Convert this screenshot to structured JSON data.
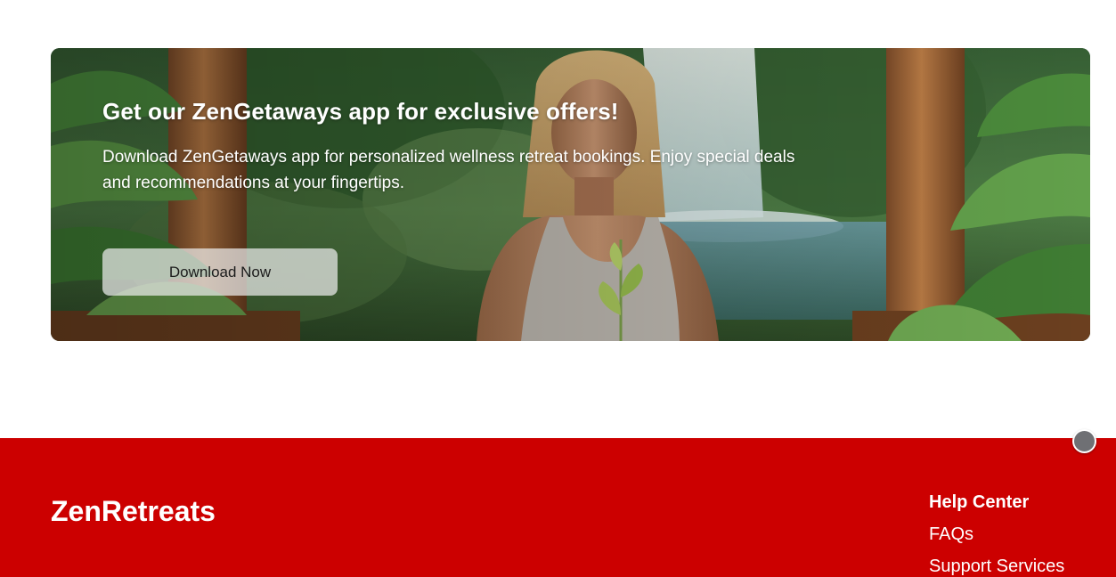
{
  "promo": {
    "title": "Get our ZenGetaways app for exclusive offers!",
    "description": "Download ZenGetaways app for personalized wellness retreat bookings. Enjoy special deals and recommendations at your fingertips.",
    "button_label": "Download Now"
  },
  "footer": {
    "brand": "ZenRetreats",
    "background_color": "#cc0000",
    "help_center": {
      "title": "Help Center",
      "links": [
        "FAQs",
        "Support Services"
      ]
    }
  }
}
